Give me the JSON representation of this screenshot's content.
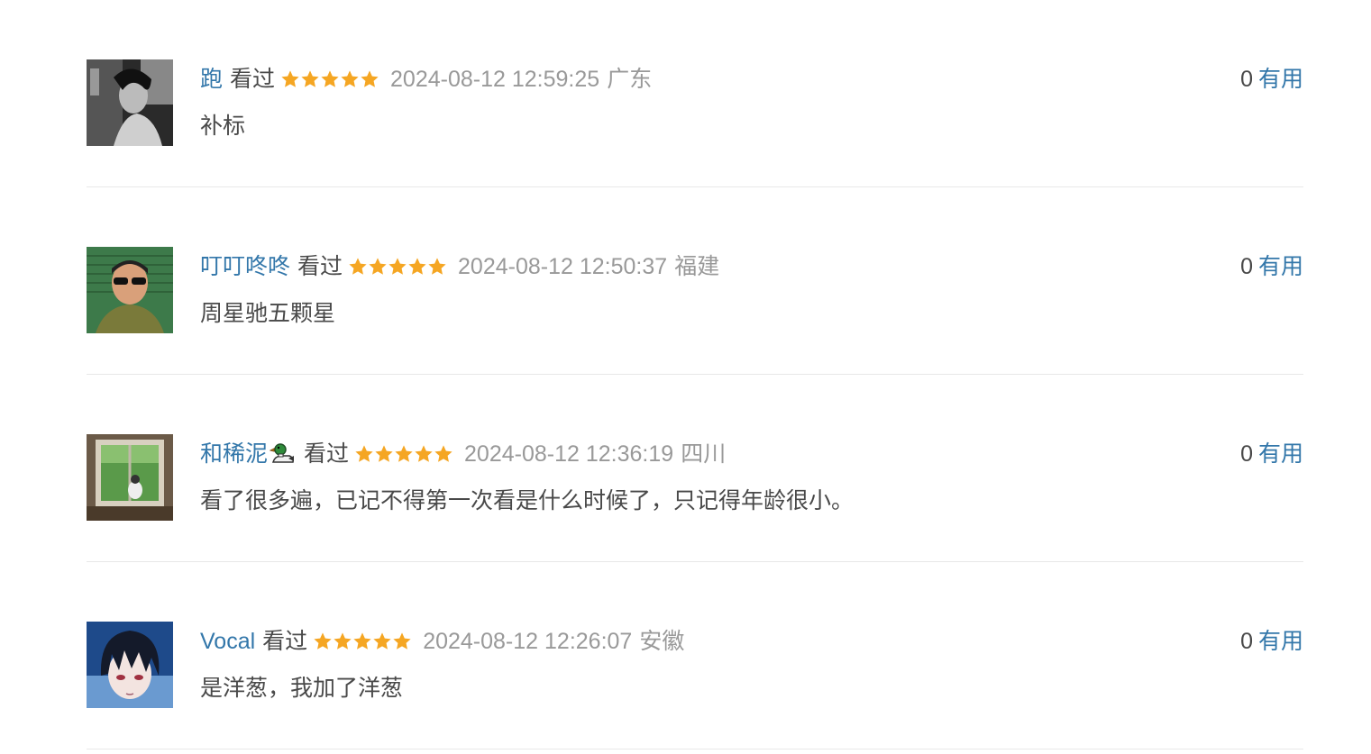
{
  "accent_color": "#3377aa",
  "star_color": "#f5a623",
  "comments": [
    {
      "avatar_icon": "avatar-bw-portrait",
      "username": "跑",
      "status": "看过",
      "rating": 5,
      "time": "2024-08-12 12:59:25",
      "location": "广东",
      "content": "补标",
      "votes": "0",
      "vote_label": "有用"
    },
    {
      "avatar_icon": "avatar-man-sunglasses",
      "username": "叮叮咚咚",
      "status": "看过",
      "rating": 5,
      "time": "2024-08-12 12:50:37",
      "location": "福建",
      "content": "周星驰五颗星",
      "votes": "0",
      "vote_label": "有用"
    },
    {
      "avatar_icon": "avatar-window-view",
      "username": "和稀泥",
      "badge_icon": "duck-icon",
      "status": "看过",
      "rating": 5,
      "time": "2024-08-12 12:36:19",
      "location": "四川",
      "content": "看了很多遍，已记不得第一次看是什么时候了，只记得年龄很小。",
      "votes": "0",
      "vote_label": "有用"
    },
    {
      "avatar_icon": "avatar-anime-boy",
      "username": "Vocal",
      "status": "看过",
      "rating": 5,
      "time": "2024-08-12 12:26:07",
      "location": "安徽",
      "content": "是洋葱，我加了洋葱",
      "votes": "0",
      "vote_label": "有用"
    }
  ]
}
